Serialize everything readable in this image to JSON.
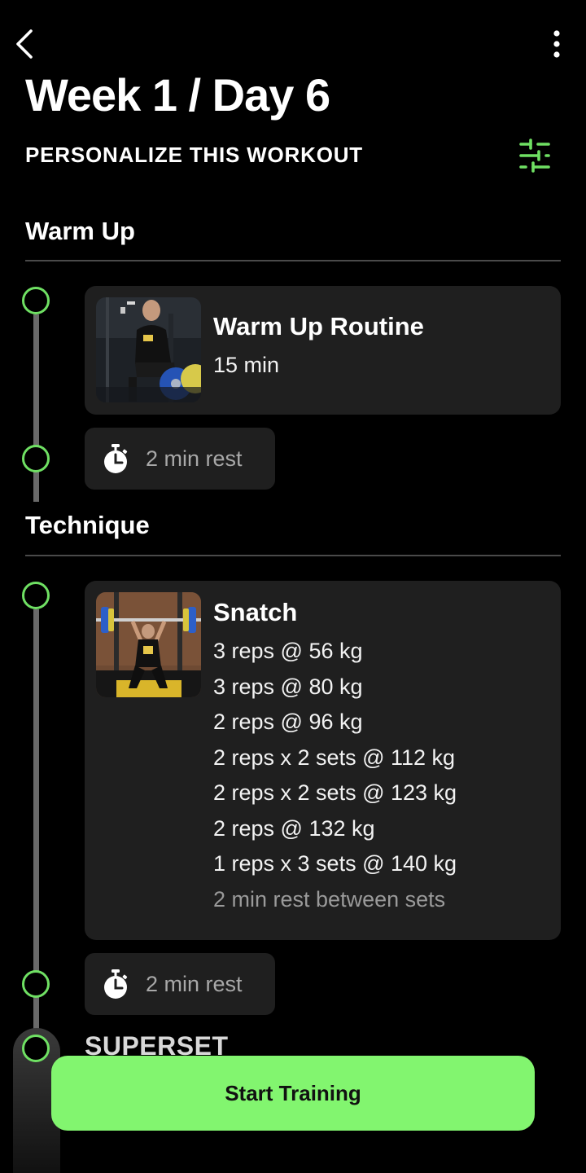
{
  "header": {
    "title": "Week 1 / Day 6",
    "subtitle": "PERSONALIZE THIS WORKOUT"
  },
  "sections": {
    "warmup": {
      "title": "Warm Up",
      "card": {
        "title": "Warm Up Routine",
        "duration": "15 min"
      },
      "rest": "2 min rest"
    },
    "technique": {
      "title": "Technique",
      "card": {
        "title": "Snatch",
        "lines": [
          "3 reps @ 56 kg",
          "3 reps @ 80 kg",
          "2 reps @ 96 kg",
          "2 reps x 2 sets @ 112 kg",
          "2 reps x 2 sets @ 123 kg",
          "2 reps @ 132 kg",
          "1 reps x 3 sets @ 140 kg"
        ],
        "note": "2 min rest between sets"
      },
      "rest": "2 min rest"
    },
    "superset": {
      "label": "SUPERSET"
    }
  },
  "cta": {
    "label": "Start Training"
  },
  "colors": {
    "accent": "#82f56f",
    "dot": "#6fe063",
    "card": "#1f1f1f",
    "background": "#000000"
  },
  "icons": [
    "chevron-left-icon",
    "more-vertical-icon",
    "sliders-icon",
    "stopwatch-icon"
  ]
}
